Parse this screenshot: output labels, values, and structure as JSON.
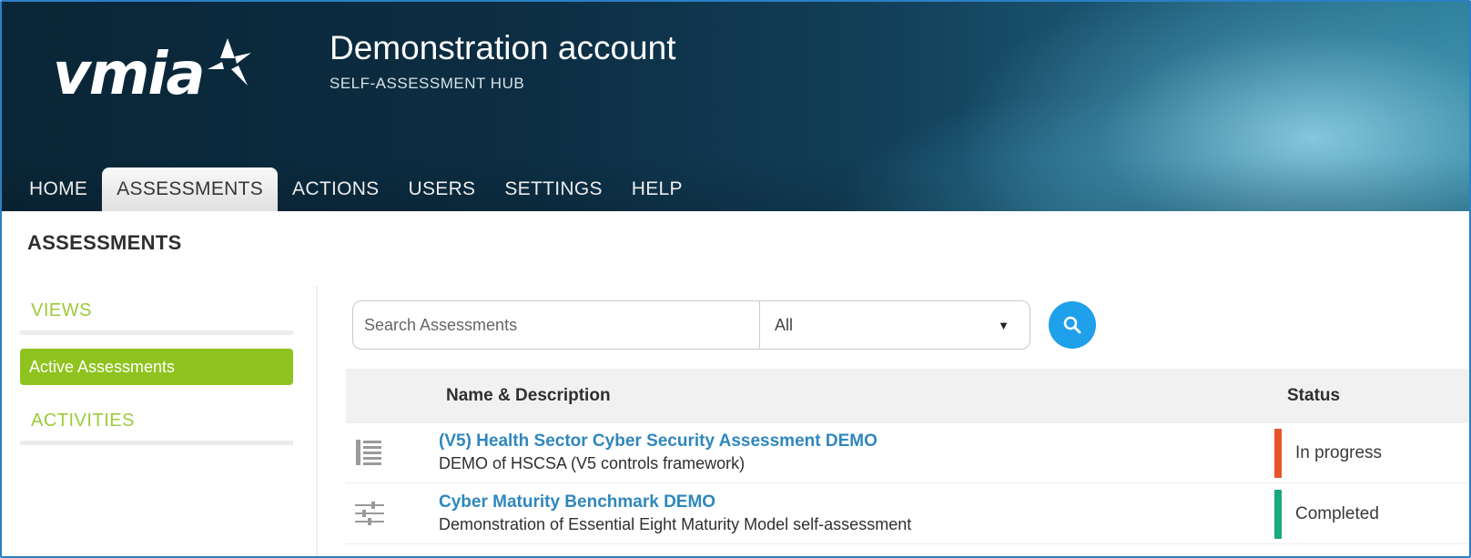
{
  "header": {
    "logo_text": "vmia",
    "account_title": "Demonstration account",
    "account_subtitle": "SELF-ASSESSMENT HUB"
  },
  "tabs": [
    {
      "label": "HOME",
      "active": false
    },
    {
      "label": "ASSESSMENTS",
      "active": true
    },
    {
      "label": "ACTIONS",
      "active": false
    },
    {
      "label": "USERS",
      "active": false
    },
    {
      "label": "SETTINGS",
      "active": false
    },
    {
      "label": "HELP",
      "active": false
    }
  ],
  "page": {
    "title": "ASSESSMENTS"
  },
  "sidebar": {
    "views_heading": "VIEWS",
    "active_item": "Active Assessments",
    "activities_heading": "ACTIVITIES"
  },
  "search": {
    "placeholder": "Search Assessments",
    "filter_value": "All",
    "button_icon": "search-icon"
  },
  "table": {
    "columns": {
      "name": "Name & Description",
      "status": "Status"
    },
    "rows": [
      {
        "icon": "list-icon",
        "title": "(V5) Health Sector Cyber Security Assessment DEMO",
        "description": "DEMO of HSCSA (V5 controls framework)",
        "status": "In progress",
        "status_color": "#e8542a"
      },
      {
        "icon": "sliders-icon",
        "title": "Cyber Maturity Benchmark DEMO",
        "description": "Demonstration of Essential Eight Maturity Model self-assessment",
        "status": "Completed",
        "status_color": "#1aa87f"
      }
    ]
  },
  "colors": {
    "accent_green": "#8fc31f",
    "link_blue": "#2f87bc",
    "search_blue": "#1ea0ea"
  }
}
